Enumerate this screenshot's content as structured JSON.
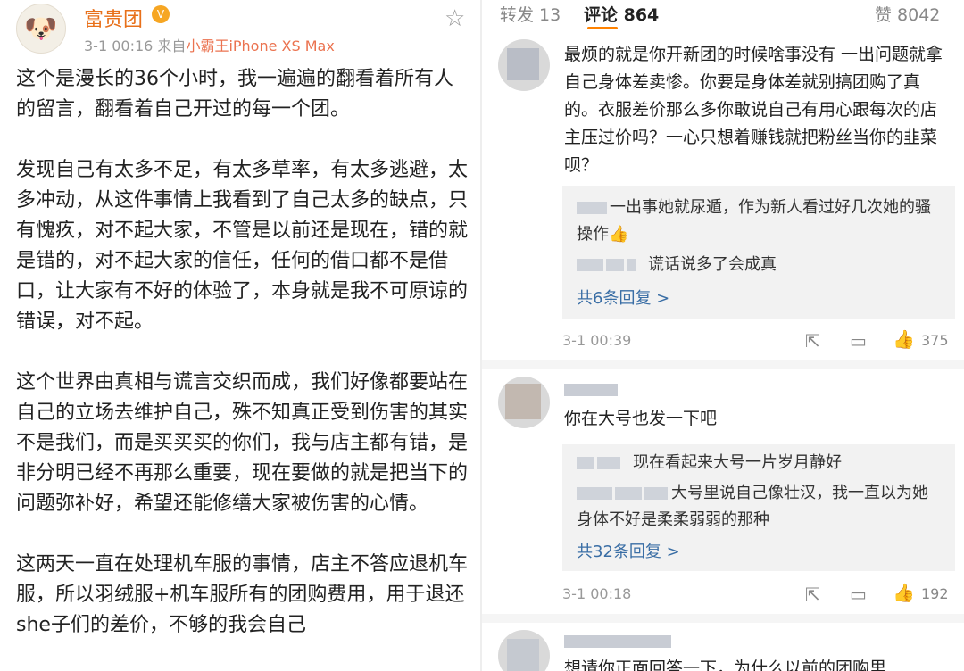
{
  "post": {
    "user_name": "富贵团",
    "meta_time": "3-1 00:16",
    "meta_source_prefix": "来自",
    "meta_source": "小霸王iPhone XS Max",
    "paragraphs": [
      "这个是漫长的36个小时，我一遍遍的翻看着所有人的留言，翻看着自己开过的每一个团。",
      "发现自己有太多不足，有太多草率，有太多逃避，太多冲动，从这件事情上我看到了自己太多的缺点，只有愧疚，对不起大家，不管是以前还是现在，错的就是错的，对不起大家的信任，任何的借口都不是借口，让大家有不好的体验了，本身就是我不可原谅的错误，对不起。",
      "这个世界由真相与谎言交织而成，我们好像都要站在自己的立场去维护自己，殊不知真正受到伤害的其实不是我们，而是买买买的你们，我与店主都有错，是非分明已经不再那么重要，现在要做的就是把当下的问题弥补好，希望还能修缮大家被伤害的心情。",
      "这两天一直在处理机车服的事情，店主不答应退机车服，所以羽绒服+机车服所有的团购费用，用于退还she子们的差价，不够的我会自己"
    ]
  },
  "tabs": {
    "repost": "转发 13",
    "comment": "评论 864",
    "like": "赞 8042"
  },
  "comments": [
    {
      "text": "最烦的就是你开新团的时候啥事没有 一出问题就拿自己身体差卖惨。你要是身体差就别搞团购了真的。衣服差价那么多你敢说自己有用心跟每次的店主压过价吗？一心只想着赚钱就把粉丝当你的韭菜呗？",
      "reply1": "一出事她就尿遁，作为新人看过好几次她的骚操作👍",
      "reply2": "谎话说多了会成真",
      "more": "共6条回复 >",
      "time": "3-1 00:39",
      "likes": "375"
    },
    {
      "text": "你在大号也发一下吧",
      "reply1": "现在看起来大号一片岁月静好",
      "reply2": "大号里说自己像壮汉，我一直以为她身体不好是柔柔弱弱的那种",
      "more": "共32条回复 >",
      "time": "3-1 00:18",
      "likes": "192"
    },
    {
      "text": "想请你正面回答一下，为什么以前的团购里"
    }
  ]
}
